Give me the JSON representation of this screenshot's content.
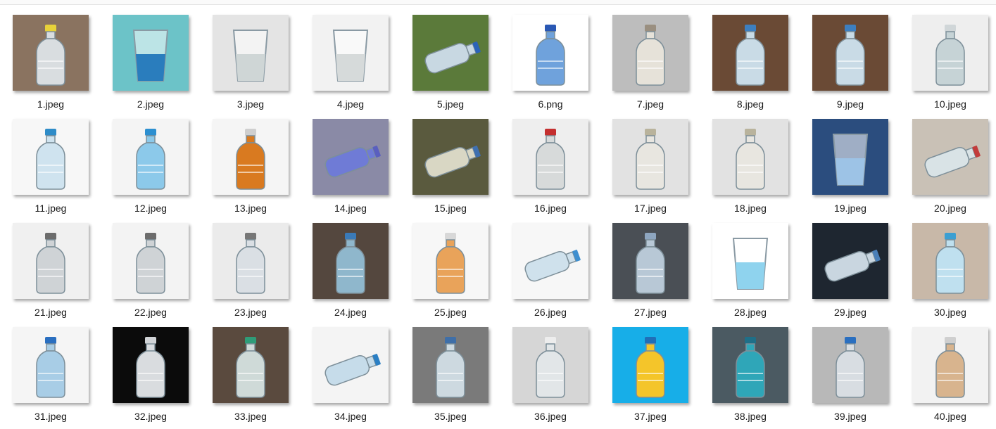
{
  "files": [
    {
      "name": "1.jpeg",
      "bg": "#8a7360",
      "liquid": "#d9dde0",
      "shape": "bottle",
      "cap": "#e8d23a"
    },
    {
      "name": "2.jpeg",
      "bg": "#6cc3c8",
      "liquid": "#2a7dbd",
      "shape": "glass",
      "cap": "none"
    },
    {
      "name": "3.jpeg",
      "bg": "#e4e4e4",
      "liquid": "#cfd6d6",
      "shape": "glass",
      "cap": "none"
    },
    {
      "name": "4.jpeg",
      "bg": "#f2f2f2",
      "liquid": "#d6dada",
      "shape": "glass",
      "cap": "none"
    },
    {
      "name": "5.jpeg",
      "bg": "#5b7a3a",
      "liquid": "#c8d8e2",
      "shape": "lying",
      "cap": "#2b63b8"
    },
    {
      "name": "6.png",
      "bg": "#ffffff",
      "liquid": "#6fa2dc",
      "shape": "bottle",
      "cap": "#2a58b4"
    },
    {
      "name": "7.jpeg",
      "bg": "#bdbdbd",
      "liquid": "#e6e2d9",
      "shape": "bottle",
      "cap": "#9a8f80"
    },
    {
      "name": "8.jpeg",
      "bg": "#6a4a35",
      "liquid": "#c9dbe6",
      "shape": "bottle",
      "cap": "#3d7fc0"
    },
    {
      "name": "9.jpeg",
      "bg": "#6a4a35",
      "liquid": "#c9dbe6",
      "shape": "bottle",
      "cap": "#3d7fc0"
    },
    {
      "name": "10.jpeg",
      "bg": "#eeeeee",
      "liquid": "#c6d3d6",
      "shape": "bottle",
      "cap": "#d0d6d8"
    },
    {
      "name": "11.jpeg",
      "bg": "#f7f7f7",
      "liquid": "#cfe3ef",
      "shape": "bottle",
      "cap": "#2f8cc8"
    },
    {
      "name": "12.jpeg",
      "bg": "#f4f4f4",
      "liquid": "#8cc9ea",
      "shape": "bottle",
      "cap": "#2c8fd0"
    },
    {
      "name": "13.jpeg",
      "bg": "#f5f5f5",
      "liquid": "#d97a20",
      "shape": "bottle",
      "cap": "#cfcfcf"
    },
    {
      "name": "14.jpeg",
      "bg": "#8a8aa6",
      "liquid": "#6f7bd6",
      "shape": "lying",
      "cap": "#5a5fbf"
    },
    {
      "name": "15.jpeg",
      "bg": "#5a5a3e",
      "liquid": "#d9d7c4",
      "shape": "lying",
      "cap": "#3f70b0"
    },
    {
      "name": "16.jpeg",
      "bg": "#eeeeee",
      "liquid": "#d7dada",
      "shape": "bottle",
      "cap": "#c42f2f"
    },
    {
      "name": "17.jpeg",
      "bg": "#e2e2e2",
      "liquid": "#e8e6e0",
      "shape": "bottle",
      "cap": "#b9b39c"
    },
    {
      "name": "18.jpeg",
      "bg": "#e2e2e2",
      "liquid": "#e8e6e0",
      "shape": "bottle",
      "cap": "#b9b39c"
    },
    {
      "name": "19.jpeg",
      "bg": "#2b4d7e",
      "liquid": "#9dc3e6",
      "shape": "glass",
      "cap": "none"
    },
    {
      "name": "20.jpeg",
      "bg": "#c9c1b6",
      "liquid": "#d9e3e6",
      "shape": "lying",
      "cap": "#c23c3c"
    },
    {
      "name": "21.jpeg",
      "bg": "#f0f0f0",
      "liquid": "#cfd3d6",
      "shape": "bottle",
      "cap": "#6c6c6c"
    },
    {
      "name": "22.jpeg",
      "bg": "#f3f3f3",
      "liquid": "#cfd3d6",
      "shape": "bottle",
      "cap": "#6c6c6c"
    },
    {
      "name": "23.jpeg",
      "bg": "#ebebeb",
      "liquid": "#dadfe4",
      "shape": "bottle",
      "cap": "#777777"
    },
    {
      "name": "24.jpeg",
      "bg": "#54473e",
      "liquid": "#8fb7cc",
      "shape": "bottle",
      "cap": "#3a7ab8"
    },
    {
      "name": "25.jpeg",
      "bg": "#f7f7f7",
      "liquid": "#e9a35a",
      "shape": "bottle",
      "cap": "#d8d8d8"
    },
    {
      "name": "26.jpeg",
      "bg": "#f7f7f7",
      "liquid": "#cfe1ec",
      "shape": "lying",
      "cap": "#3d8fd0"
    },
    {
      "name": "27.jpeg",
      "bg": "#4a4f55",
      "liquid": "#b8c8d6",
      "shape": "bottle",
      "cap": "#8ea6c0"
    },
    {
      "name": "28.jpeg",
      "bg": "#ffffff",
      "liquid": "#8fd3ee",
      "shape": "glass",
      "cap": "none"
    },
    {
      "name": "29.jpeg",
      "bg": "#1e2630",
      "liquid": "#c9d6e0",
      "shape": "lying",
      "cap": "#4a7fb8"
    },
    {
      "name": "30.jpeg",
      "bg": "#c8b8a8",
      "liquid": "#bfe0ef",
      "shape": "bottle",
      "cap": "#3c9fd2"
    },
    {
      "name": "31.jpeg",
      "bg": "#f5f5f5",
      "liquid": "#a8cde6",
      "shape": "bottle",
      "cap": "#2a6fc0"
    },
    {
      "name": "32.jpeg",
      "bg": "#0b0b0b",
      "liquid": "#d9dcdf",
      "shape": "bottle",
      "cap": "#d0d3d6"
    },
    {
      "name": "33.jpeg",
      "bg": "#5a4a3e",
      "liquid": "#cfdad8",
      "shape": "bottle",
      "cap": "#2f9c78"
    },
    {
      "name": "34.jpeg",
      "bg": "#f4f4f4",
      "liquid": "#c6dcea",
      "shape": "lying",
      "cap": "#2b7fc4"
    },
    {
      "name": "35.jpeg",
      "bg": "#7a7a7a",
      "liquid": "#cdd9e0",
      "shape": "bottle",
      "cap": "#3f6fa8"
    },
    {
      "name": "36.jpeg",
      "bg": "#d6d6d6",
      "liquid": "#e2e6e8",
      "shape": "bottle",
      "cap": "#ededed"
    },
    {
      "name": "37.jpeg",
      "bg": "#17aee8",
      "liquid": "#f4c52a",
      "shape": "bottle",
      "cap": "#1f6fb8"
    },
    {
      "name": "38.jpeg",
      "bg": "#4b5a62",
      "liquid": "#2fa6b8",
      "shape": "bottle",
      "cap": "#1f6f88"
    },
    {
      "name": "39.jpeg",
      "bg": "#b8b8b8",
      "liquid": "#d8dde2",
      "shape": "bottle",
      "cap": "#2a6fc0"
    },
    {
      "name": "40.jpeg",
      "bg": "#f2f2f2",
      "liquid": "#d8b48e",
      "shape": "bottle",
      "cap": "#cfcfcf"
    }
  ]
}
